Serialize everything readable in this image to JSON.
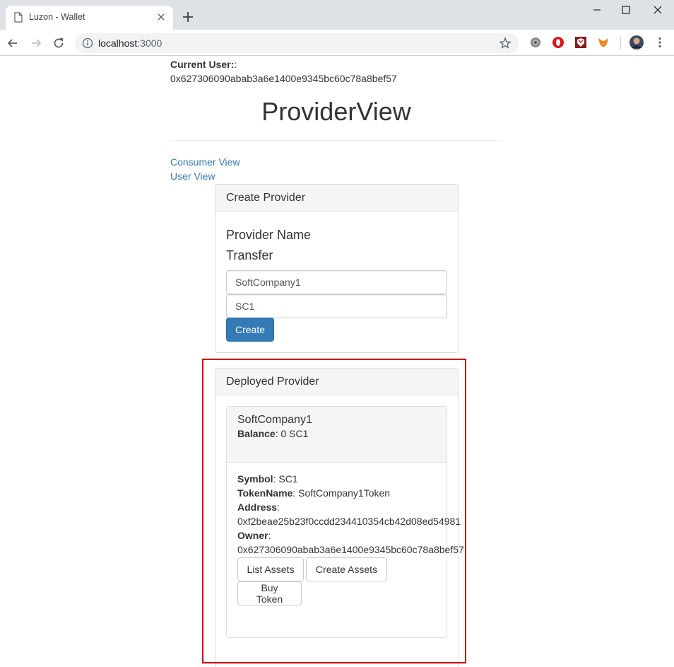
{
  "browser": {
    "tab_title": "Luzon - Wallet",
    "url_host": "localhost",
    "url_port": ":3000"
  },
  "page": {
    "current_user_label": "Current User:",
    "current_user_suffix": ":",
    "current_user_address": "0x627306090abab3a6e1400e9345bc60c78a8bef57",
    "title": "ProviderView",
    "links": {
      "consumer_view": "Consumer View",
      "user_view": "User View"
    }
  },
  "create_provider": {
    "heading": "Create Provider",
    "provider_name_label": "Provider Name",
    "transfer_label": "Transfer",
    "provider_name_value": "SoftCompany1",
    "transfer_value": "SC1",
    "create_button": "Create"
  },
  "deployed_provider": {
    "heading": "Deployed Provider",
    "providers": [
      {
        "name": "SoftCompany1",
        "balance_label": "Balance",
        "balance_value": ": 0 SC1",
        "symbol_label": "Symbol",
        "symbol_value": ": SC1",
        "token_name_label": "TokenName",
        "token_name_value": ": SoftCompany1Token",
        "address_label": "Address",
        "address_colon": ":",
        "address_value": "0xf2beae25b23f0ccdd234410354cb42d08ed54981",
        "owner_label": "Owner",
        "owner_colon": ":",
        "owner_value": "0x627306090abab3a6e1400e9345bc60c78a8bef57",
        "buttons": {
          "list_assets": "List Assets",
          "create_assets": "Create Assets",
          "buy_token": "Buy Token"
        }
      }
    ]
  },
  "colors": {
    "link": "#337ab7",
    "primary_button": "#337ab7",
    "highlight_border": "#d00000",
    "panel_heading_bg": "#f5f5f5"
  }
}
